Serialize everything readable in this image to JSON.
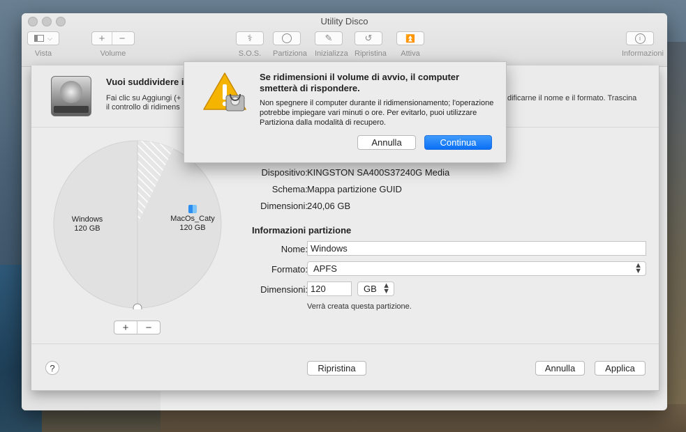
{
  "window": {
    "title": "Utility Disco"
  },
  "toolbar": {
    "vista": "Vista",
    "volume": "Volume",
    "volume_add": "+",
    "volume_remove": "−",
    "sos": "S.O.S.",
    "partiziona": "Partiziona",
    "inizializza": "Inizializza",
    "ripristina": "Ripristina",
    "attiva": "Attiva",
    "informazioni": "Informazioni"
  },
  "sheet": {
    "title": "Vuoi suddividere i",
    "description": "Fai clic su Aggiungi (+",
    "description_tail": "dificarne il nome e il formato. Trascina",
    "description_line2": "il controllo di ridimens",
    "pie": {
      "partitions": [
        {
          "name": "Windows",
          "size": "120 GB",
          "fraction": 0.5
        },
        {
          "name": "MacOs_Caty",
          "size": "120 GB",
          "fraction": 0.5
        }
      ],
      "add": "+",
      "remove": "−"
    },
    "device_info": {
      "dispositivo_label": "Dispositivo:",
      "dispositivo_value": "KINGSTON SA400S37240G Media",
      "schema_label": "Schema:",
      "schema_value": "Mappa partizione GUID",
      "dimensioni_label": "Dimensioni:",
      "dimensioni_value": "240,06 GB"
    },
    "partition_info": {
      "title": "Informazioni partizione",
      "nome_label": "Nome:",
      "nome_value": "Windows",
      "formato_label": "Formato:",
      "formato_value": "APFS",
      "dimensioni_label": "Dimensioni:",
      "dimensioni_value": "120",
      "unit_value": "GB",
      "note": "Verrà creata questa partizione."
    },
    "footer": {
      "help": "?",
      "ripristina": "Ripristina",
      "annulla": "Annulla",
      "applica": "Applica"
    }
  },
  "alert": {
    "title": "Se ridimensioni il volume di avvio, il computer smetterà di rispondere.",
    "message": "Non spegnere il computer durante il ridimensionamento; l'operazione potrebbe impiegare vari minuti o ore. Per evitarlo, puoi utilizzare Partiziona dalla modalità di recupero.",
    "cancel": "Annulla",
    "continue": "Continua"
  },
  "colors": {
    "accent": "#0a6ff6",
    "warning": "#f5b400"
  }
}
